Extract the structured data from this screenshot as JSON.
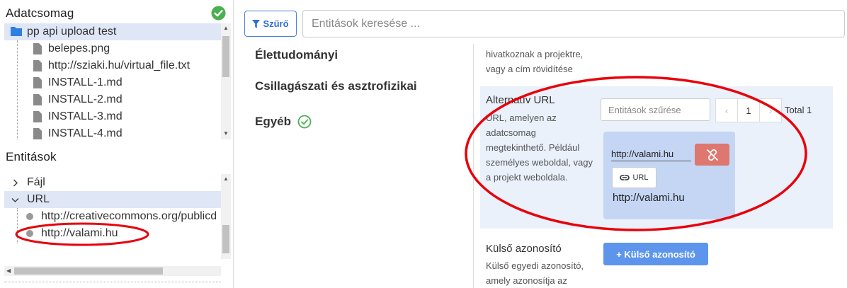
{
  "left": {
    "dataset_title": "Adatcsomag",
    "dataset_tree": [
      {
        "label": "pp api upload test",
        "kind": "folder",
        "selected": true
      },
      {
        "label": "belepes.png",
        "kind": "file"
      },
      {
        "label": "http://sziaki.hu/virtual_file.txt",
        "kind": "file"
      },
      {
        "label": "INSTALL-1.md",
        "kind": "file"
      },
      {
        "label": "INSTALL-2.md",
        "kind": "file"
      },
      {
        "label": "INSTALL-3.md",
        "kind": "file"
      },
      {
        "label": "INSTALL-4.md",
        "kind": "file"
      }
    ],
    "entities_title": "Entitások",
    "entity_tree": [
      {
        "label": "Fájl",
        "kind": "collapsed"
      },
      {
        "label": "URL",
        "kind": "expanded",
        "selected": true
      },
      {
        "label": "http://creativecommons.org/publicd",
        "kind": "leaf"
      },
      {
        "label": "http://valami.hu",
        "kind": "leaf"
      }
    ]
  },
  "toolbar": {
    "filter_label": "Szűrő",
    "search_placeholder": "Entitások keresése ..."
  },
  "categories": [
    "Élettudományi",
    "Csillagászati és asztrofizikai",
    "Egyéb"
  ],
  "fields": {
    "top_desc": "hivatkoznak a projektre, vagy a cím rövidítése",
    "alt_url": {
      "title": "Alternatív URL",
      "desc": "URL, amelyen az adatcsomag megtekinthető. Például személyes weboldal, vagy a projekt weboldala.",
      "filter_placeholder": "Entitások szűrése",
      "pager_prev": "‹",
      "pager_page": "1",
      "pager_next": "›",
      "total": "Total 1",
      "input_value": "http://valami.hu",
      "url_button": "URL",
      "value": "http://valami.hu"
    },
    "external_id": {
      "title": "Külső azonosító",
      "desc": "Külső egyedi azonosító, amely azonosítja az",
      "button": "+ Külső azonosító"
    }
  },
  "colors": {
    "accent": "#2f6fd6",
    "success": "#4caf50",
    "danger": "#dd7770",
    "annotation": "#e8000b"
  }
}
